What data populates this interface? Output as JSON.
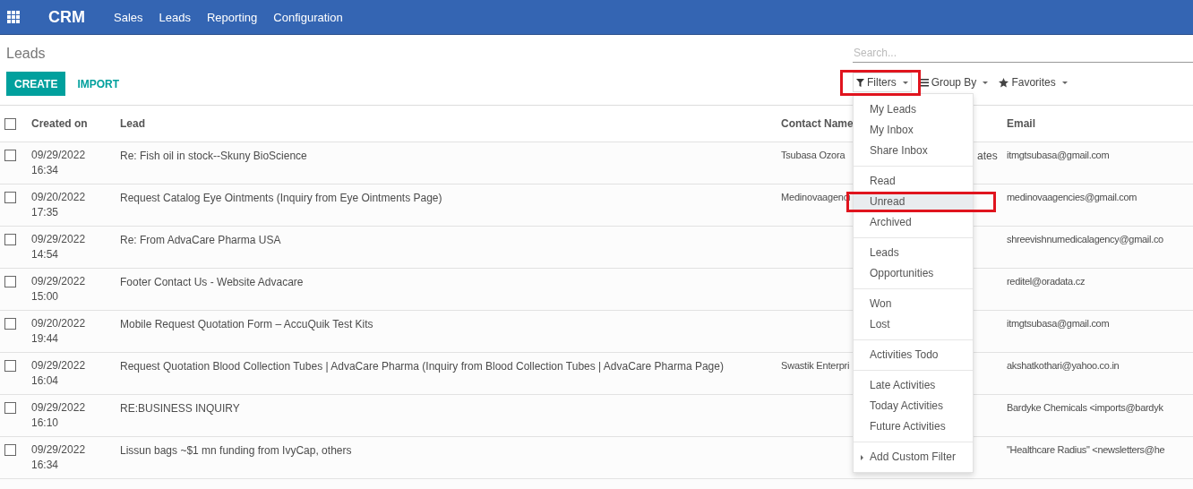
{
  "navbar": {
    "app_name": "CRM",
    "menu": [
      "Sales",
      "Leads",
      "Reporting",
      "Configuration"
    ]
  },
  "breadcrumb": "Leads",
  "search": {
    "placeholder": "Search..."
  },
  "buttons": [
    {
      "label": "CREATE",
      "kind": "primary"
    },
    {
      "label": "IMPORT",
      "kind": "link"
    }
  ],
  "search_options": [
    {
      "label": "Filters",
      "kind": "filter",
      "expanded": true,
      "highlighted": true
    },
    {
      "label": "Group By",
      "kind": "group"
    },
    {
      "label": "Favorites",
      "kind": "star"
    }
  ],
  "table": {
    "select_all_checked": false,
    "columns": [
      "Created on",
      "Lead",
      "Contact Name",
      "Email"
    ],
    "rows": [
      {
        "checked": false,
        "date": "09/29/2022",
        "time": "16:34",
        "lead": "Re: Fish oil in stock--Skuny BioScience",
        "contact": "Tsubasa Ozora",
        "column_4": "ates",
        "email": "itmgtsubasa@gmail.com"
      },
      {
        "checked": false,
        "date": "09/20/2022",
        "time": "17:35",
        "lead": "Request Catalog Eye Ointments (Inquiry from Eye Ointments Page)",
        "contact": "Medinovaagenci",
        "email": "medinovaagencies@gmail.com"
      },
      {
        "checked": false,
        "date": "09/29/2022",
        "time": "14:54",
        "lead": "Re: From AdvaCare Pharma USA",
        "email": "shreevishnumedicalagency@gmail.co"
      },
      {
        "checked": false,
        "date": "09/29/2022",
        "time": "15:00",
        "lead": "Footer Contact Us - Website Advacare",
        "email": "reditel@oradata.cz"
      },
      {
        "checked": false,
        "date": "09/20/2022",
        "time": "19:44",
        "lead": "Mobile Request Quotation Form – AccuQuik Test Kits",
        "email": "itmgtsubasa@gmail.com"
      },
      {
        "checked": false,
        "date": "09/29/2022",
        "time": "16:04",
        "lead": "Request Quotation Blood Collection Tubes | AdvaCare Pharma (Inquiry from Blood Collection Tubes | AdvaCare Pharma Page)",
        "contact": "Swastik Enterpri",
        "email": "akshatkothari@yahoo.co.in"
      },
      {
        "checked": false,
        "date": "09/29/2022",
        "time": "16:10",
        "lead": "RE:BUSINESS INQUIRY",
        "email": "Bardyke Chemicals <imports@bardyk"
      },
      {
        "checked": false,
        "date": "09/29/2022",
        "time": "16:34",
        "lead": "Lissun bags ~$1 mn funding from IvyCap, others",
        "email": "\"Healthcare Radius\" <newsletters@he"
      }
    ]
  },
  "filter_menu": {
    "groups": [
      [
        {
          "label": "My Leads",
          "selected": false
        },
        {
          "label": "My Inbox",
          "selected": false
        },
        {
          "label": "Share Inbox",
          "selected": false
        }
      ],
      [
        {
          "label": "Read",
          "selected": false
        },
        {
          "label": "Unread",
          "selected": true,
          "highlighted": true
        },
        {
          "label": "Archived",
          "selected": false
        }
      ],
      [
        {
          "label": "Leads",
          "selected": false
        },
        {
          "label": "Opportunities",
          "selected": false
        }
      ],
      [
        {
          "label": "Won",
          "selected": false
        },
        {
          "label": "Lost",
          "selected": false
        }
      ],
      [
        {
          "label": "Activities Todo",
          "selected": false
        }
      ],
      [
        {
          "label": "Late Activities",
          "selected": false
        },
        {
          "label": "Today Activities",
          "selected": false
        },
        {
          "label": "Future Activities",
          "selected": false
        }
      ]
    ],
    "custom": "Add Custom Filter"
  }
}
